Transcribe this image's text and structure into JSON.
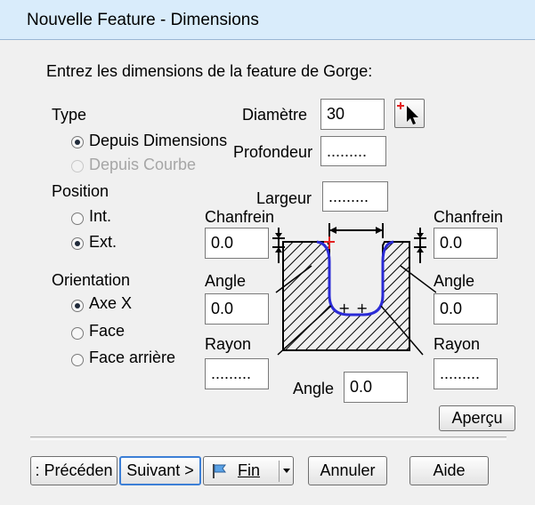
{
  "window": {
    "title": "Nouvelle Feature - Dimensions"
  },
  "intro": {
    "text": "Entrez les dimensions de la feature de Gorge:"
  },
  "type_group": {
    "label": "Type",
    "opt1": "Depuis Dimensions",
    "opt2": "Depuis Courbe",
    "selected": "Depuis Dimensions"
  },
  "position_group": {
    "label": "Position",
    "opt1": "Int.",
    "opt2": "Ext.",
    "selected": "Ext."
  },
  "orientation_group": {
    "label": "Orientation",
    "opt1": "Axe X",
    "opt2": "Face",
    "opt3": "Face arrière",
    "selected": "Axe X"
  },
  "fields": {
    "diametre_label": "Diamètre",
    "diametre_value": "30",
    "profondeur_label": "Profondeur",
    "profondeur_value": ".........",
    "largeur_label": "Largeur",
    "largeur_value": ".........",
    "chanfrein_left_label": "Chanfrein",
    "chanfrein_left_value": "0.0",
    "chanfrein_right_label": "Chanfrein",
    "chanfrein_right_value": "0.0",
    "angle_left_label": "Angle",
    "angle_left_value": "0.0",
    "angle_right_label": "Angle",
    "angle_right_value": "0.0",
    "rayon_left_label": "Rayon",
    "rayon_left_value": ".........",
    "rayon_right_label": "Rayon",
    "rayon_right_value": ".........",
    "angle_bottom_label": "Angle",
    "angle_bottom_value": "0.0"
  },
  "buttons": {
    "apercu": "Aperçu",
    "precedent": ": Précéden",
    "suivant": "Suivant >",
    "fin": "Fin",
    "annuler": "Annuler",
    "aide": "Aide"
  },
  "colors": {
    "profile_blue": "#2b2bd6",
    "marker_red": "#e32222",
    "hatch": "#000000"
  }
}
